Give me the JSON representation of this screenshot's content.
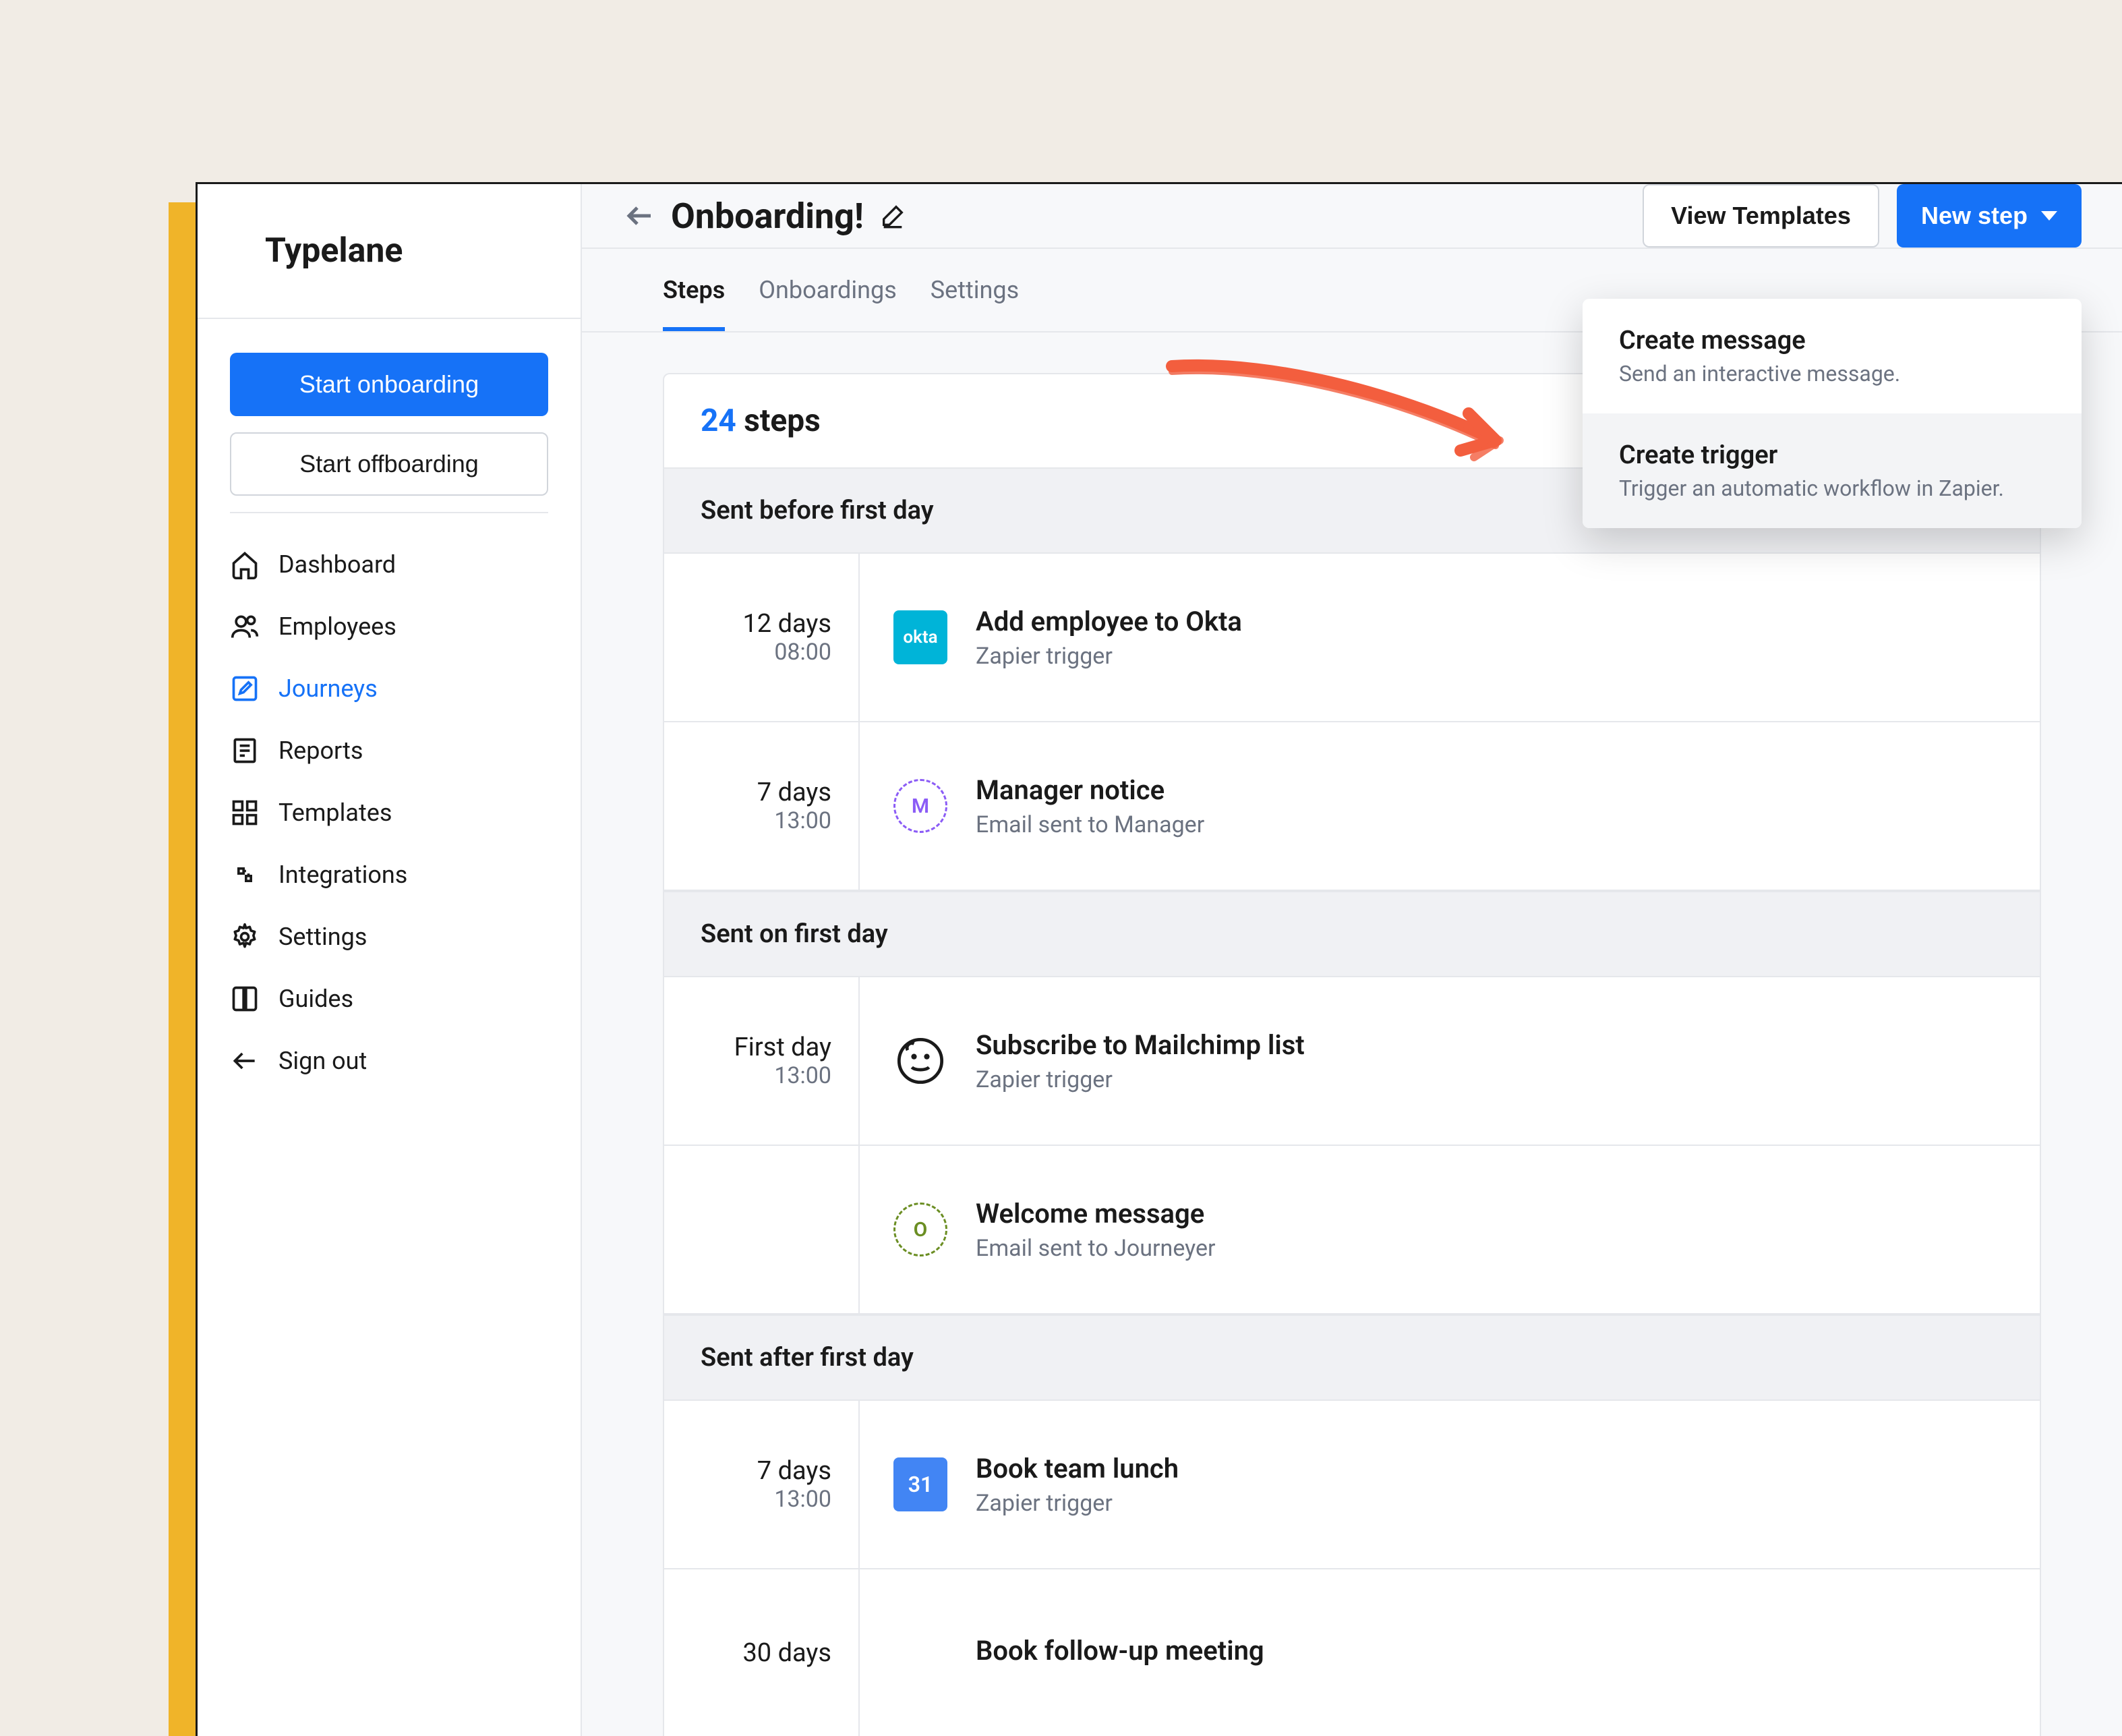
{
  "brand": "Typelane",
  "sidebar": {
    "start_onboarding": "Start onboarding",
    "start_offboarding": "Start offboarding",
    "items": [
      {
        "label": "Dashboard"
      },
      {
        "label": "Employees"
      },
      {
        "label": "Journeys"
      },
      {
        "label": "Reports"
      },
      {
        "label": "Templates"
      },
      {
        "label": "Integrations"
      },
      {
        "label": "Settings"
      },
      {
        "label": "Guides"
      },
      {
        "label": "Sign out"
      }
    ]
  },
  "header": {
    "title": "Onboarding!",
    "view_templates": "View Templates",
    "new_step": "New step"
  },
  "tabs": [
    {
      "label": "Steps"
    },
    {
      "label": "Onboardings"
    },
    {
      "label": "Settings"
    }
  ],
  "count": {
    "num": "24",
    "label": " steps"
  },
  "sections": [
    {
      "title": "Sent before first day",
      "steps": [
        {
          "days": "12 days",
          "hour": "08:00",
          "title": "Add employee to Okta",
          "sub": "Zapier trigger",
          "icon": "okta",
          "icon_text": "okta"
        },
        {
          "days": "7 days",
          "hour": "13:00",
          "title": "Manager notice",
          "sub": "Email sent to Manager",
          "icon": "letter-m",
          "icon_text": "M"
        }
      ]
    },
    {
      "title": "Sent on first day",
      "steps": [
        {
          "days": "First day",
          "hour": "13:00",
          "title": "Subscribe to Mailchimp list",
          "sub": "Zapier trigger",
          "icon": "mailchimp",
          "icon_text": ""
        },
        {
          "days": "",
          "hour": "",
          "title": "Welcome message",
          "sub": "Email sent to Journeyer",
          "icon": "letter-o",
          "icon_text": "O"
        }
      ]
    },
    {
      "title": "Sent after first day",
      "steps": [
        {
          "days": "7 days",
          "hour": "13:00",
          "title": "Book team lunch",
          "sub": "Zapier trigger",
          "icon": "calendar",
          "icon_text": "31"
        },
        {
          "days": "30 days",
          "hour": "",
          "title": "Book follow-up meeting",
          "sub": "",
          "icon": "",
          "icon_text": ""
        }
      ]
    }
  ],
  "dropdown": {
    "items": [
      {
        "title": "Create message",
        "desc": "Send an interactive message."
      },
      {
        "title": "Create trigger",
        "desc": "Trigger an automatic workflow in Zapier."
      }
    ]
  }
}
